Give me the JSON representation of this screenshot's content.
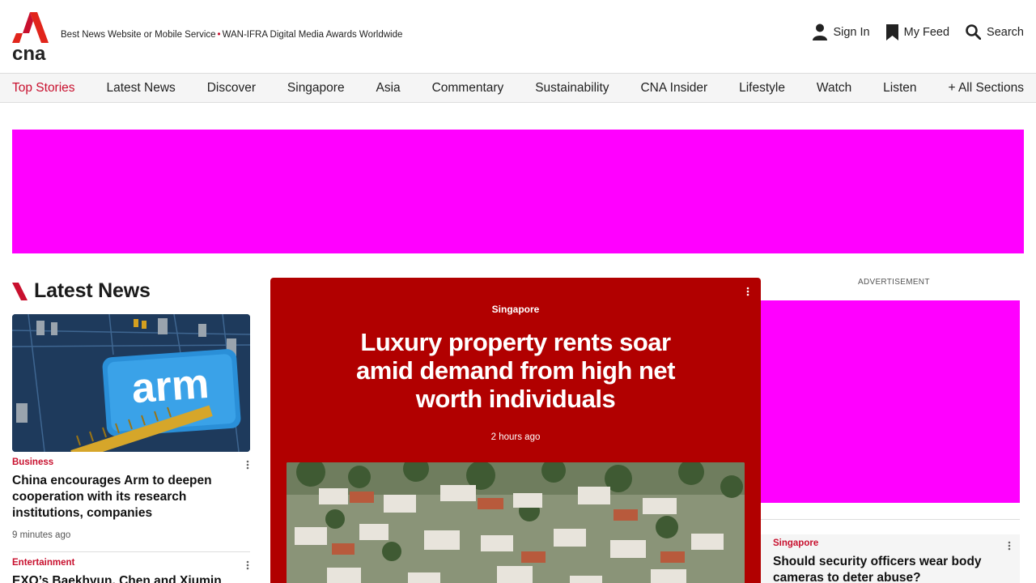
{
  "header": {
    "logo_text": "cna",
    "award_left": "Best News Website or Mobile Service",
    "award_dot": "•",
    "award_right": "WAN-IFRA Digital Media Awards Worldwide",
    "sign_in": "Sign In",
    "my_feed": "My Feed",
    "search": "Search"
  },
  "nav": {
    "items": [
      "Top Stories",
      "Latest News",
      "Discover",
      "Singapore",
      "Asia",
      "Commentary",
      "Sustainability",
      "CNA Insider",
      "Lifestyle",
      "Watch",
      "Listen",
      "+ All Sections"
    ]
  },
  "ads": {
    "label": "ADVERTISEMENT"
  },
  "latest_news": {
    "heading": "Latest News",
    "items": [
      {
        "image_text": "arm",
        "category": "Business",
        "title_line1": "China encourages Arm to deepen",
        "title_line2": "cooperation with its research",
        "title_line3": "institutions, companies",
        "time": "9 minutes ago"
      },
      {
        "category": "Entertainment",
        "title_line1": "EXO’s Baekhyun, Chen and Xiumin"
      }
    ]
  },
  "hero": {
    "category": "Singapore",
    "title_line1": "Luxury property rents soar",
    "title_line2": "amid demand from high net",
    "title_line3": "worth individuals",
    "time": "2 hours ago"
  },
  "right_card": {
    "category": "Singapore",
    "title_line1": "Should security officers wear body",
    "title_line2": "cameras to deter abuse?"
  },
  "colors": {
    "brand_red": "#c8102e",
    "hero_red": "#b10000",
    "ad_magenta": "#ff00ff"
  }
}
